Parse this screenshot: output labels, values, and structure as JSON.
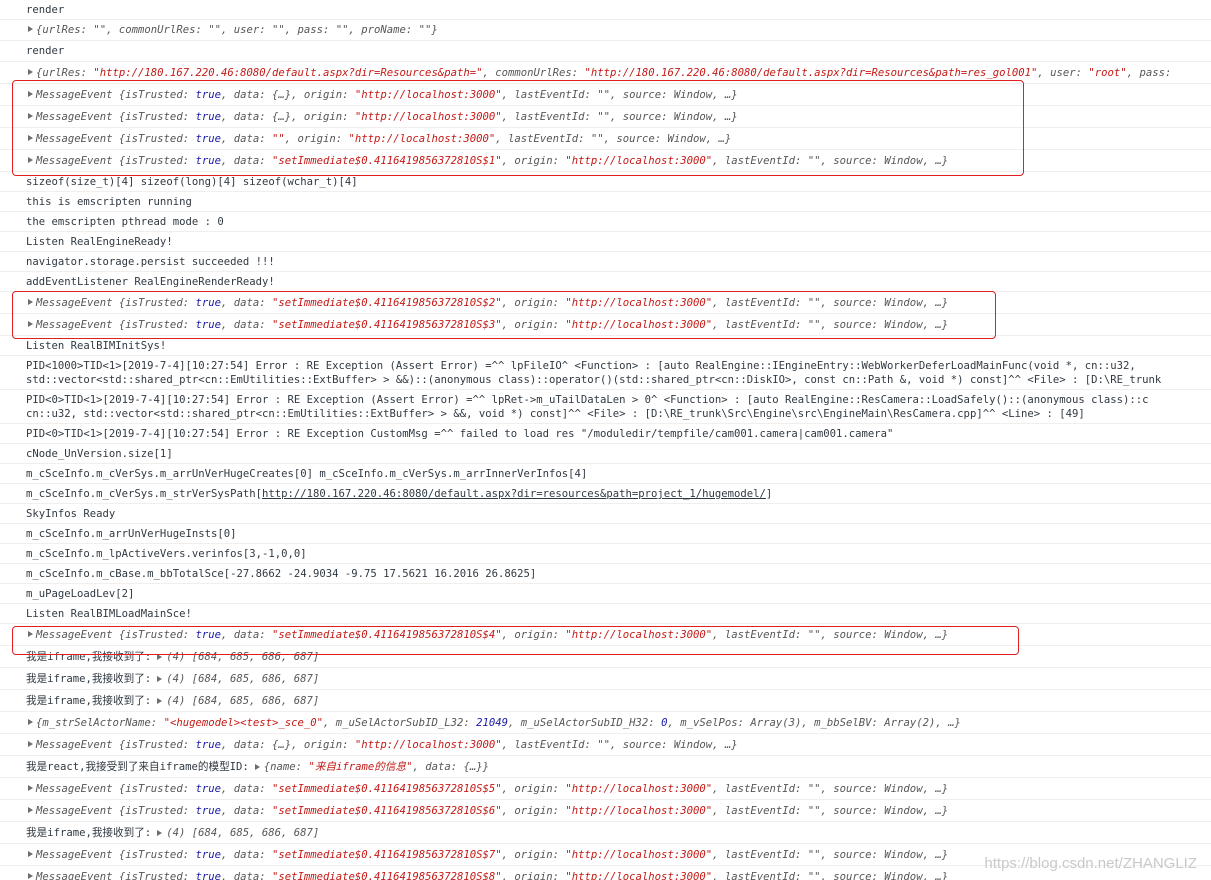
{
  "console": {
    "render_1": "render",
    "obj_urlres_1": "{urlRes: \"\", commonUrlRes: \"\", user: \"\", pass: \"\", proName: \"\"}",
    "render_2": "render",
    "obj_urlres_2": {
      "prefix": "{urlRes: ",
      "url_value": "\"http://180.167.220.46:8080/default.aspx?dir=Resources&path=\"",
      "mid": ", commonUrlRes: ",
      "common_value": "\"http://180.167.220.46:8080/default.aspx?dir=Resources&path=res_gol001\"",
      "user_key": ", user: ",
      "user_value": "\"root\"",
      "pass_key": ", pass:"
    },
    "msg_event_data_obj": "{…}",
    "msg_event_data_empty": "\"\"",
    "msg_prefix": "MessageEvent {isTrusted: ",
    "true_literal": "true",
    "data_key": ", data: ",
    "origin_key": ", origin: ",
    "origin_value": "\"http://localhost:3000\"",
    "tail": ", lastEventId: \"\", source: Window, …}",
    "set_immediate": {
      "s1": "\"setImmediate$0.4116419856372810S$1\"",
      "s2": "\"setImmediate$0.4116419856372810S$2\"",
      "s3": "\"setImmediate$0.4116419856372810S$3\"",
      "s4": "\"setImmediate$0.4116419856372810S$4\"",
      "s5": "\"setImmediate$0.4116419856372810S$5\"",
      "s6": "\"setImmediate$0.4116419856372810S$6\"",
      "s7": "\"setImmediate$0.4116419856372810S$7\"",
      "s8": "\"setImmediate$0.4116419856372810S$8\""
    },
    "log_sizeof": "sizeof(size_t)[4] sizeof(long)[4] sizeof(wchar_t)[4]",
    "log_emscripten": "this is emscripten running",
    "log_pthread": "the emscripten pthread mode : 0",
    "log_listen_engine": "Listen RealEngineReady!",
    "log_persist": "navigator.storage.persist succeeded !!!",
    "log_add_listener": "addEventListener RealEngineRenderReady!",
    "log_listen_bim": "Listen RealBIMInitSys!",
    "error_1_line1": "PID<1000>TID<1>[2019-7-4][10:27:54] Error : RE Exception (Assert Error) =^^ lpFileIO^   <Function> : [auto RealEngine::IEngineEntry::WebWorkerDeferLoadMainFunc(void *, cn::u32,",
    "error_1_line2": "std::vector<std::shared_ptr<cn::EmUtilities::ExtBuffer> > &&)::(anonymous class)::operator()(std::shared_ptr<cn::DiskIO>, const cn::Path &, void *) const]^^    <File> : [D:\\RE_trunk",
    "error_2_line1": "PID<0>TID<1>[2019-7-4][10:27:54] Error : RE Exception (Assert Error) =^^    lpRet->m_uTailDataLen > 0^  <Function> : [auto RealEngine::ResCamera::LoadSafely()::(anonymous class)::c",
    "error_2_line2": "cn::u32, std::vector<std::shared_ptr<cn::EmUtilities::ExtBuffer> > &&, void *) const]^^ <File> : [D:\\RE_trunk\\Src\\Engine\\src\\EngineMain\\ResCamera.cpp]^^    <Line> : [49]",
    "error_3": "PID<0>TID<1>[2019-7-4][10:27:54] Error : RE Exception CustomMsg =^^ failed to load res \"/moduledir/tempfile/cam001.camera|cam001.camera\"",
    "log_unversion": "cNode_UnVersion.size[1]",
    "log_huge_creates": "m_cSceInfo.m_cVerSys.m_arrUnVerHugeCreates[0] m_cSceInfo.m_cVerSys.m_arrInnerVerInfos[4]",
    "log_versys_prefix": "m_cSceInfo.m_cVerSys.m_strVerSysPath[",
    "log_versys_link": "http://180.167.220.46:8080/default.aspx?dir=resources&path=project_1/hugemodel/",
    "log_versys_suffix": "]",
    "log_sky": "SkyInfos Ready",
    "log_huge_insts": "m_cSceInfo.m_arrUnVerHugeInsts[0]",
    "log_active_vers": "m_cSceInfo.m_lpActiveVers.verinfos[3,-1,0,0]",
    "log_bbox": "m_cSceInfo.m_cBase.m_bbTotalSce[-27.8662 -24.9034 -9.75 17.5621 16.2016 26.8625]",
    "log_page_load": "m_uPageLoadLev[2]",
    "log_listen_main": "Listen RealBIMLoadMainSce!",
    "iframe_label": "我是iframe,我接收到了:",
    "iframe_array": "(4) [684, 685, 686, 687]",
    "obj_actor": {
      "prefix": "{m_strSelActorName: ",
      "name_value": "\"<hugemodel><test>_sce_0\"",
      "sub_l32_key": ", m_uSelActorSubID_L32: ",
      "sub_l32_value": "21049",
      "sub_h32_key": ", m_uSelActorSubID_H32: ",
      "sub_h32_value": "0",
      "rest": ", m_vSelPos: Array(3), m_bbSelBV: Array(2), …}"
    },
    "react_label": "我是react,我接受到了来自iframe的模型ID:",
    "react_obj": {
      "prefix": "{name: ",
      "name_value": "\"来自iframe的信息\"",
      "rest": ", data: {…}}"
    },
    "watermark": "https://blog.csdn.net/ZHANGLIZ"
  },
  "colors": {
    "highlight_border": "#e02020",
    "string": "#c41a16",
    "keyword": "#1a1aa6",
    "text": "#303942"
  }
}
